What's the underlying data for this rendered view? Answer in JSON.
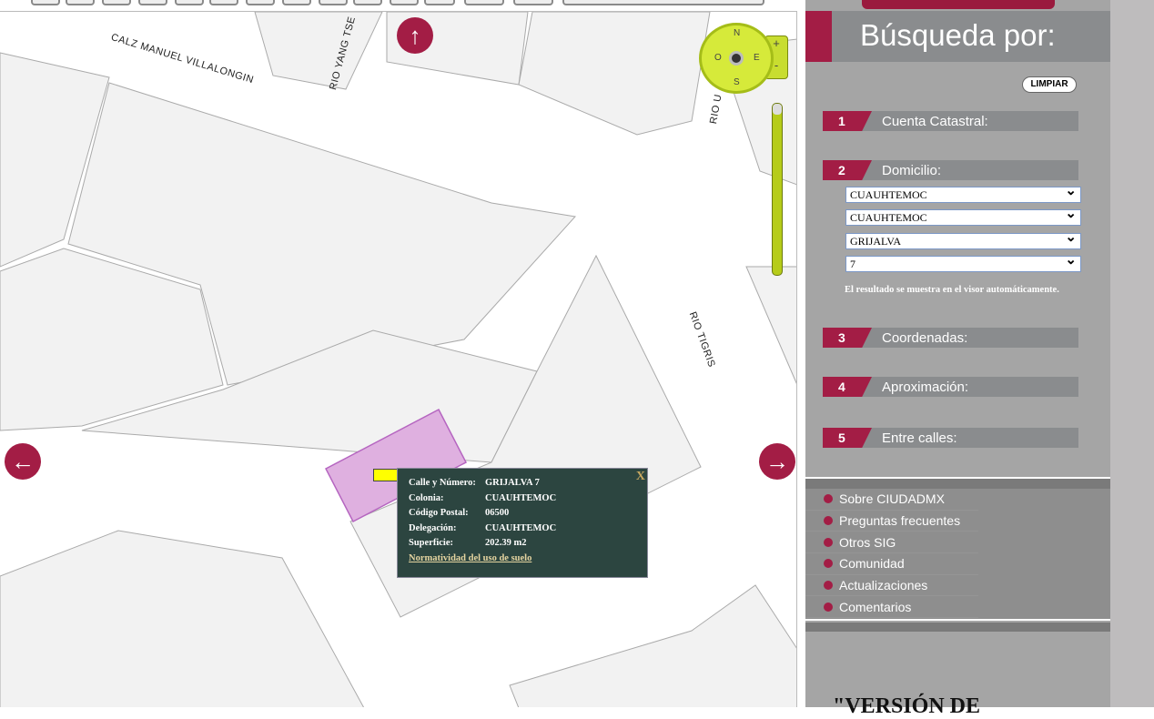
{
  "map": {
    "streets": [
      "CALZ MANUEL VILLALONGIN",
      "RIO YANG TSE",
      "RIO U",
      "RIO TIGRIS"
    ],
    "compass": {
      "n": "N",
      "s": "S",
      "e": "E",
      "o": "O",
      "zoom_in": "+",
      "zoom_out": "-"
    },
    "popup": {
      "rows": [
        {
          "k": "Calle y Número:",
          "v": "GRIJALVA 7"
        },
        {
          "k": "Colonia:",
          "v": "CUAUHTEMOC"
        },
        {
          "k": "Código Postal:",
          "v": "06500"
        },
        {
          "k": "Delegación:",
          "v": "CUAUHTEMOC"
        },
        {
          "k": "Superficie:",
          "v": "202.39 m2"
        }
      ],
      "link": "Normatividad del uso de suelo",
      "close": "X"
    }
  },
  "panel": {
    "title": "Búsqueda por:",
    "clear": "LIMPIAR",
    "sections": [
      {
        "num": "1",
        "label": "Cuenta Catastral:"
      },
      {
        "num": "2",
        "label": "Domicilio:"
      },
      {
        "num": "3",
        "label": "Coordenadas:"
      },
      {
        "num": "4",
        "label": "Aproximación:"
      },
      {
        "num": "5",
        "label": "Entre calles:"
      }
    ],
    "selects": [
      "CUAUHTEMOC",
      "CUAUHTEMOC",
      "GRIJALVA",
      "7"
    ],
    "hint": "El resultado se muestra en el visor automáticamente.",
    "links": [
      "Sobre CIUDADMX",
      "Preguntas frecuentes",
      "Otros SIG",
      "Comunidad",
      "Actualizaciones",
      "Comentarios"
    ],
    "version": "\"VERSIÓN DE"
  },
  "colors": {
    "accent": "#a31d45",
    "panel": "#a5a5a5",
    "popup": "#2c4540"
  }
}
